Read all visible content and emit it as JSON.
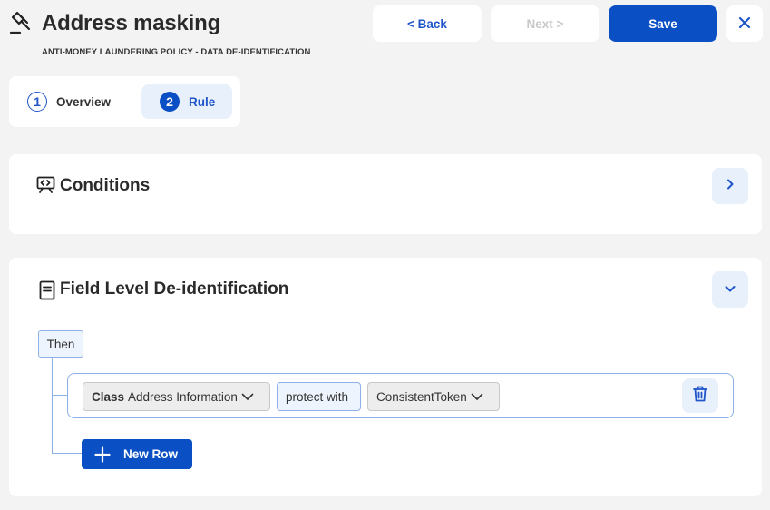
{
  "header": {
    "title": "Address masking",
    "subtitle": "ANTI-MONEY LAUNDERING POLICY - DATA DE-IDENTIFICATION",
    "back_label": "< Back",
    "next_label": "Next >",
    "save_label": "Save",
    "close_label": "✕"
  },
  "steps": [
    {
      "number": "1",
      "label": "Overview"
    },
    {
      "number": "2",
      "label": "Rule"
    }
  ],
  "conditions": {
    "title": "Conditions"
  },
  "field_level": {
    "title": "Field Level De-identification",
    "then_label": "Then",
    "rule": {
      "class_key": "Class",
      "class_value": "Address Information",
      "operator": "protect with",
      "method": "ConsistentToken"
    },
    "new_row_label": "New Row"
  },
  "colors": {
    "accent": "#0b4fc4",
    "accent_light": "#e8f0fc",
    "border": "#8db0e6"
  }
}
